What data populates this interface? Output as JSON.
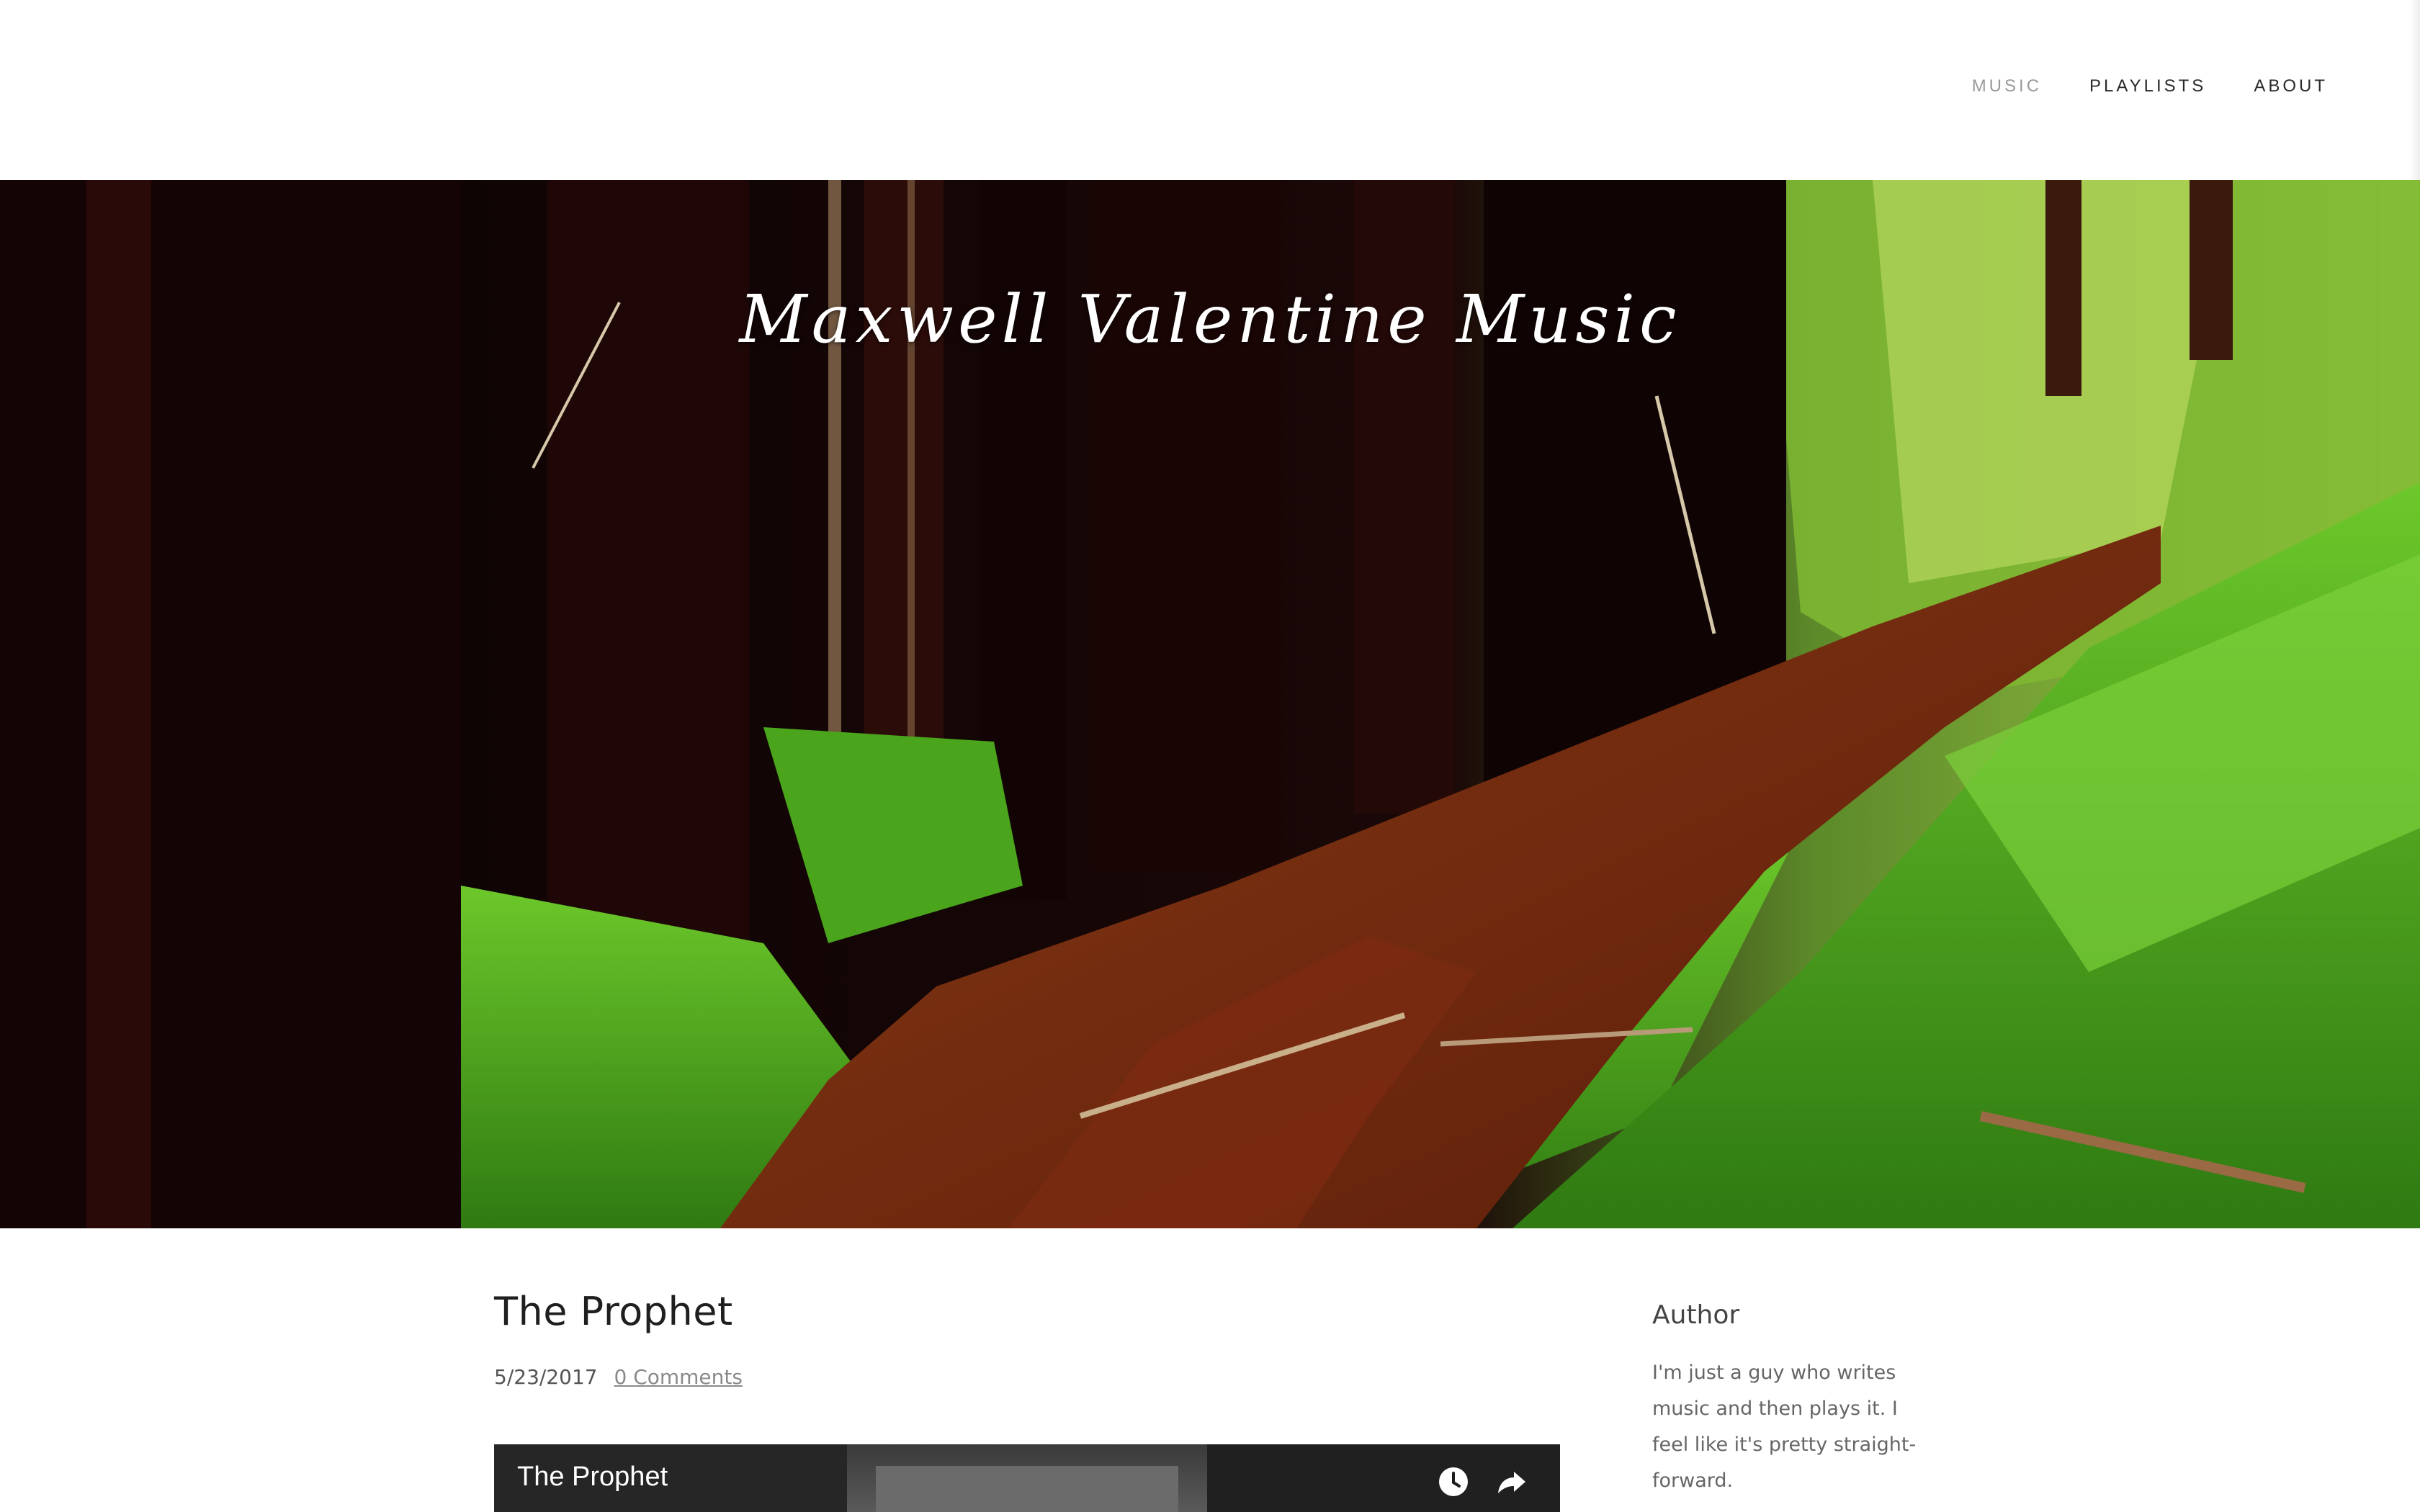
{
  "nav": {
    "items": [
      {
        "label": "MUSIC",
        "active": true
      },
      {
        "label": "PLAYLISTS",
        "active": false
      },
      {
        "label": "ABOUT",
        "active": false
      }
    ]
  },
  "hero": {
    "site_title": "Maxwell Valentine Music"
  },
  "post": {
    "title": "The Prophet",
    "date": "5/23/2017",
    "comments_link": "0 Comments",
    "video": {
      "title": "The Prophet",
      "icons": [
        "clock-icon",
        "share-icon"
      ]
    }
  },
  "sidebar": {
    "heading": "Author",
    "bio_lines": [
      "I'm just a guy who writes",
      "music and then plays it. I",
      "feel like it's pretty straight-",
      "forward."
    ]
  },
  "colors": {
    "nav_active": "#9a9a9a",
    "nav_text": "#2a2a2a",
    "moss_green": "#3fa51e",
    "trail_red": "#7a2a10"
  }
}
